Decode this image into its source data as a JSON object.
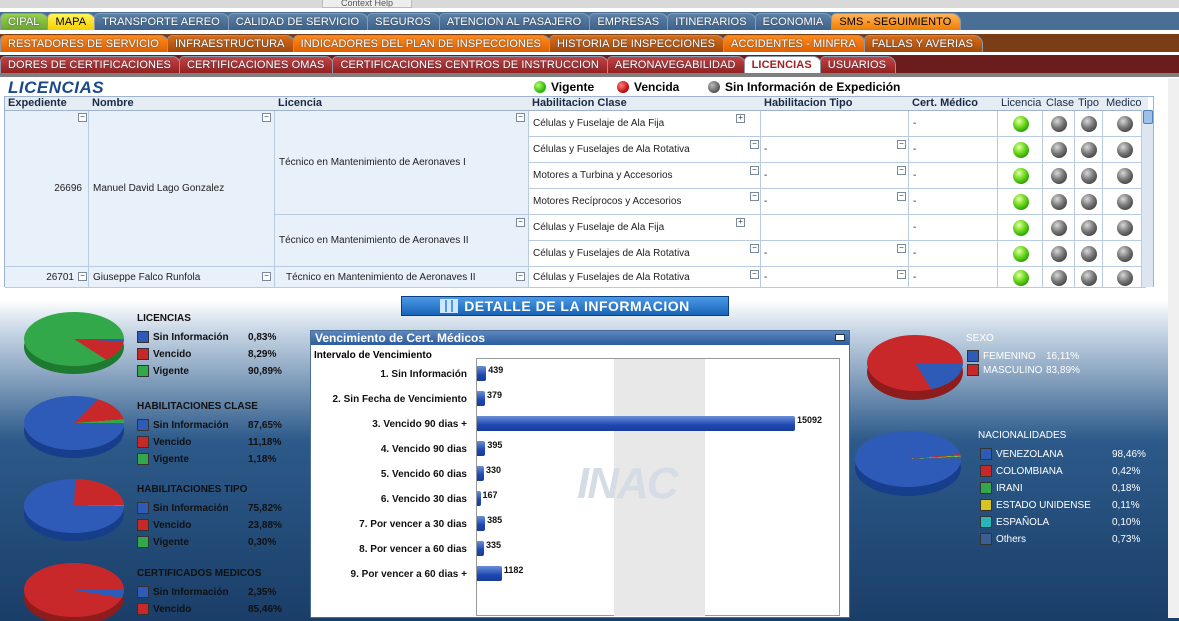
{
  "context_tooltip": "Context Help",
  "tabs_row1": [
    "CIPAL",
    "MAPA",
    "TRANSPORTE AEREO",
    "CALIDAD DE SERVICIO",
    "SEGUROS",
    "ATENCION AL PASAJERO",
    "EMPRESAS",
    "ITINERARIOS",
    "ECONOMIA",
    "SMS - SEGUIMIENTO"
  ],
  "tabs_row2": [
    "RESTADORES DE SERVICIO",
    "INFRAESTRUCTURA",
    "INDICADORES DEL PLAN DE INSPECCIONES",
    "HISTORIA DE INSPECCIONES",
    "ACCIDENTES - MINFRA",
    "FALLAS Y AVERIAS"
  ],
  "tabs_row3": [
    "DORES DE CERTIFICACIONES",
    "CERTIFICACIONES OMAS",
    "CERTIFICACIONES CENTROS DE INSTRUCCION",
    "AERONAVEGABILIDAD",
    "LICENCIAS",
    "USUARIOS"
  ],
  "page_title": "LICENCIAS",
  "status_legend": {
    "vigente": "Vigente",
    "vencida": "Vencida",
    "sin_info": "Sin Información de Expedición"
  },
  "grid": {
    "headers": {
      "expediente": "Expediente",
      "nombre": "Nombre",
      "licencia": "Licencia",
      "hab_clase": "Habilitacion Clase",
      "hab_tipo": "Habilitacion Tipo",
      "cert_medico": "Cert. Médico",
      "led_licencia": "Licencia",
      "led_clase": "Clase",
      "led_tipo": "Tipo",
      "led_medico": "Medico"
    },
    "person1": {
      "expediente": "26696",
      "nombre": "Manuel David Lago Gonzalez"
    },
    "person2": {
      "expediente": "26701",
      "nombre": "Giuseppe Falco Runfola"
    },
    "lic1": "Técnico en Mantenimiento de Aeronaves I",
    "lic2": "Técnico en Mantenimiento de Aeronaves II",
    "lic3": "Técnico en Mantenimiento de Aeronaves II",
    "clases": [
      "Células y Fuselaje de Ala Fija",
      "Células y Fuselajes de Ala Rotativa",
      "Motores a Turbina y Accesorios",
      "Motores Recíprocos y Accesorios",
      "Células y Fuselaje de Ala Fija",
      "Células y Fuselajes de Ala Rotativa",
      "Células y Fuselajes de Ala Rotativa"
    ],
    "dash": "-",
    "leds": [
      [
        "on",
        "off",
        "off",
        "off"
      ],
      [
        "on",
        "off",
        "off",
        "off"
      ],
      [
        "on",
        "off",
        "off",
        "off"
      ],
      [
        "on",
        "off",
        "off",
        "off"
      ],
      [
        "on",
        "off",
        "off",
        "off"
      ],
      [
        "on",
        "off",
        "off",
        "off"
      ],
      [
        "on",
        "off",
        "off",
        "off"
      ]
    ]
  },
  "detail_banner": "DETALLE DE LA INFORMACION",
  "pies": {
    "licencias": {
      "title": "LICENCIAS",
      "items": [
        {
          "label": "Sin Información",
          "pct": "0,83%",
          "color": "#2f5bb8"
        },
        {
          "label": "Vencido",
          "pct": "8,29%",
          "color": "#c8282a"
        },
        {
          "label": "Vigente",
          "pct": "90,89%",
          "color": "#33a84a"
        }
      ]
    },
    "clase": {
      "title": "HABILITACIONES CLASE",
      "items": [
        {
          "label": "Sin Información",
          "pct": "87,65%",
          "color": "#2f5bb8"
        },
        {
          "label": "Vencido",
          "pct": "11,18%",
          "color": "#c8282a"
        },
        {
          "label": "Vigente",
          "pct": "1,18%",
          "color": "#33a84a"
        }
      ]
    },
    "tipo": {
      "title": "HABILITACIONES TIPO",
      "items": [
        {
          "label": "Sin Información",
          "pct": "75,82%",
          "color": "#2f5bb8"
        },
        {
          "label": "Vencido",
          "pct": "23,88%",
          "color": "#c8282a"
        },
        {
          "label": "Vigente",
          "pct": "0,30%",
          "color": "#33a84a"
        }
      ]
    },
    "medicos": {
      "title": "CERTIFICADOS MEDICOS",
      "items": [
        {
          "label": "Sin Información",
          "pct": "2,35%",
          "color": "#2f5bb8"
        },
        {
          "label": "Vencido",
          "pct": "85,46%",
          "color": "#c8282a"
        }
      ]
    },
    "sexo": {
      "title": "SEXO",
      "items": [
        {
          "label": "FEMENINO",
          "pct": "16,11%",
          "color": "#2f5bb8"
        },
        {
          "label": "MASCULINO",
          "pct": "83,89%",
          "color": "#c8282a"
        }
      ]
    },
    "nacionalidades": {
      "title": "NACIONALIDADES",
      "items": [
        {
          "label": "VENEZOLANA",
          "pct": "98,46%",
          "color": "#2f5bb8"
        },
        {
          "label": "COLOMBIANA",
          "pct": "0,42%",
          "color": "#c8282a"
        },
        {
          "label": "IRANI",
          "pct": "0,18%",
          "color": "#33a84a"
        },
        {
          "label": "ESTADO UNIDENSE",
          "pct": "0,11%",
          "color": "#d6c520"
        },
        {
          "label": "ESPAÑOLA",
          "pct": "0,10%",
          "color": "#26b8b8"
        },
        {
          "label": "Others",
          "pct": "0,73%",
          "color": "#3b5f90"
        }
      ]
    }
  },
  "chart_data": {
    "type": "bar",
    "title": "Vencimiento de Cert. Médicos",
    "xlabel": "",
    "ylabel": "Intervalo de Vencimiento",
    "categories": [
      "1. Sin Información",
      "2. Sin Fecha de Vencimiento",
      "3. Vencido 90 dias +",
      "4. Vencido 90 dias",
      "5. Vencido 60 dias",
      "6. Vencido 30 dias",
      "7. Por vencer a 30 dias",
      "8. Por vencer a 60 dias",
      "9. Por vencer a 60 dias +"
    ],
    "values": [
      439,
      379,
      15092,
      395,
      330,
      167,
      385,
      335,
      1182
    ],
    "watermark": "INAC"
  }
}
